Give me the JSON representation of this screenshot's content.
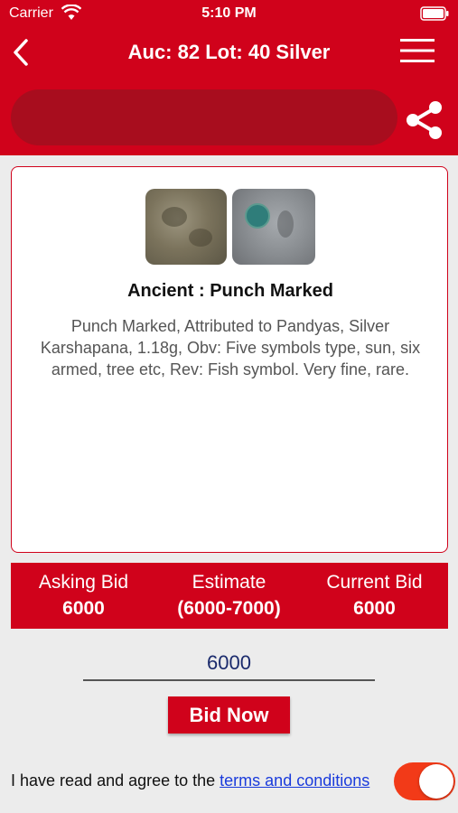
{
  "status_bar": {
    "carrier": "Carrier",
    "time": "5:10 PM"
  },
  "nav": {
    "title": "Auc: 82 Lot: 40 Silver",
    "search_placeholder": ""
  },
  "lot": {
    "title": "Ancient : Punch Marked",
    "description": "Punch Marked, Attributed to Pandyas, Silver Karshapana, 1.18g, Obv: Five symbols type, sun, six armed, tree etc, Rev: Fish symbol. Very fine, rare."
  },
  "bids": {
    "asking_label": "Asking Bid",
    "asking_value": "6000",
    "estimate_label": "Estimate",
    "estimate_value": "(6000-7000)",
    "current_label": "Current Bid",
    "current_value": "6000"
  },
  "bid_input": {
    "value": "6000"
  },
  "bid_button": {
    "label": "Bid Now"
  },
  "terms": {
    "prefix": "I have read and agree to the ",
    "link": "terms and conditions",
    "accepted": true
  },
  "colors": {
    "brand_red": "#d0021b",
    "toggle_on": "#f23a18",
    "link": "#1a3bdc"
  },
  "icons": [
    "wifi-icon",
    "battery-icon",
    "back-icon",
    "menu-icon",
    "share-icon"
  ]
}
